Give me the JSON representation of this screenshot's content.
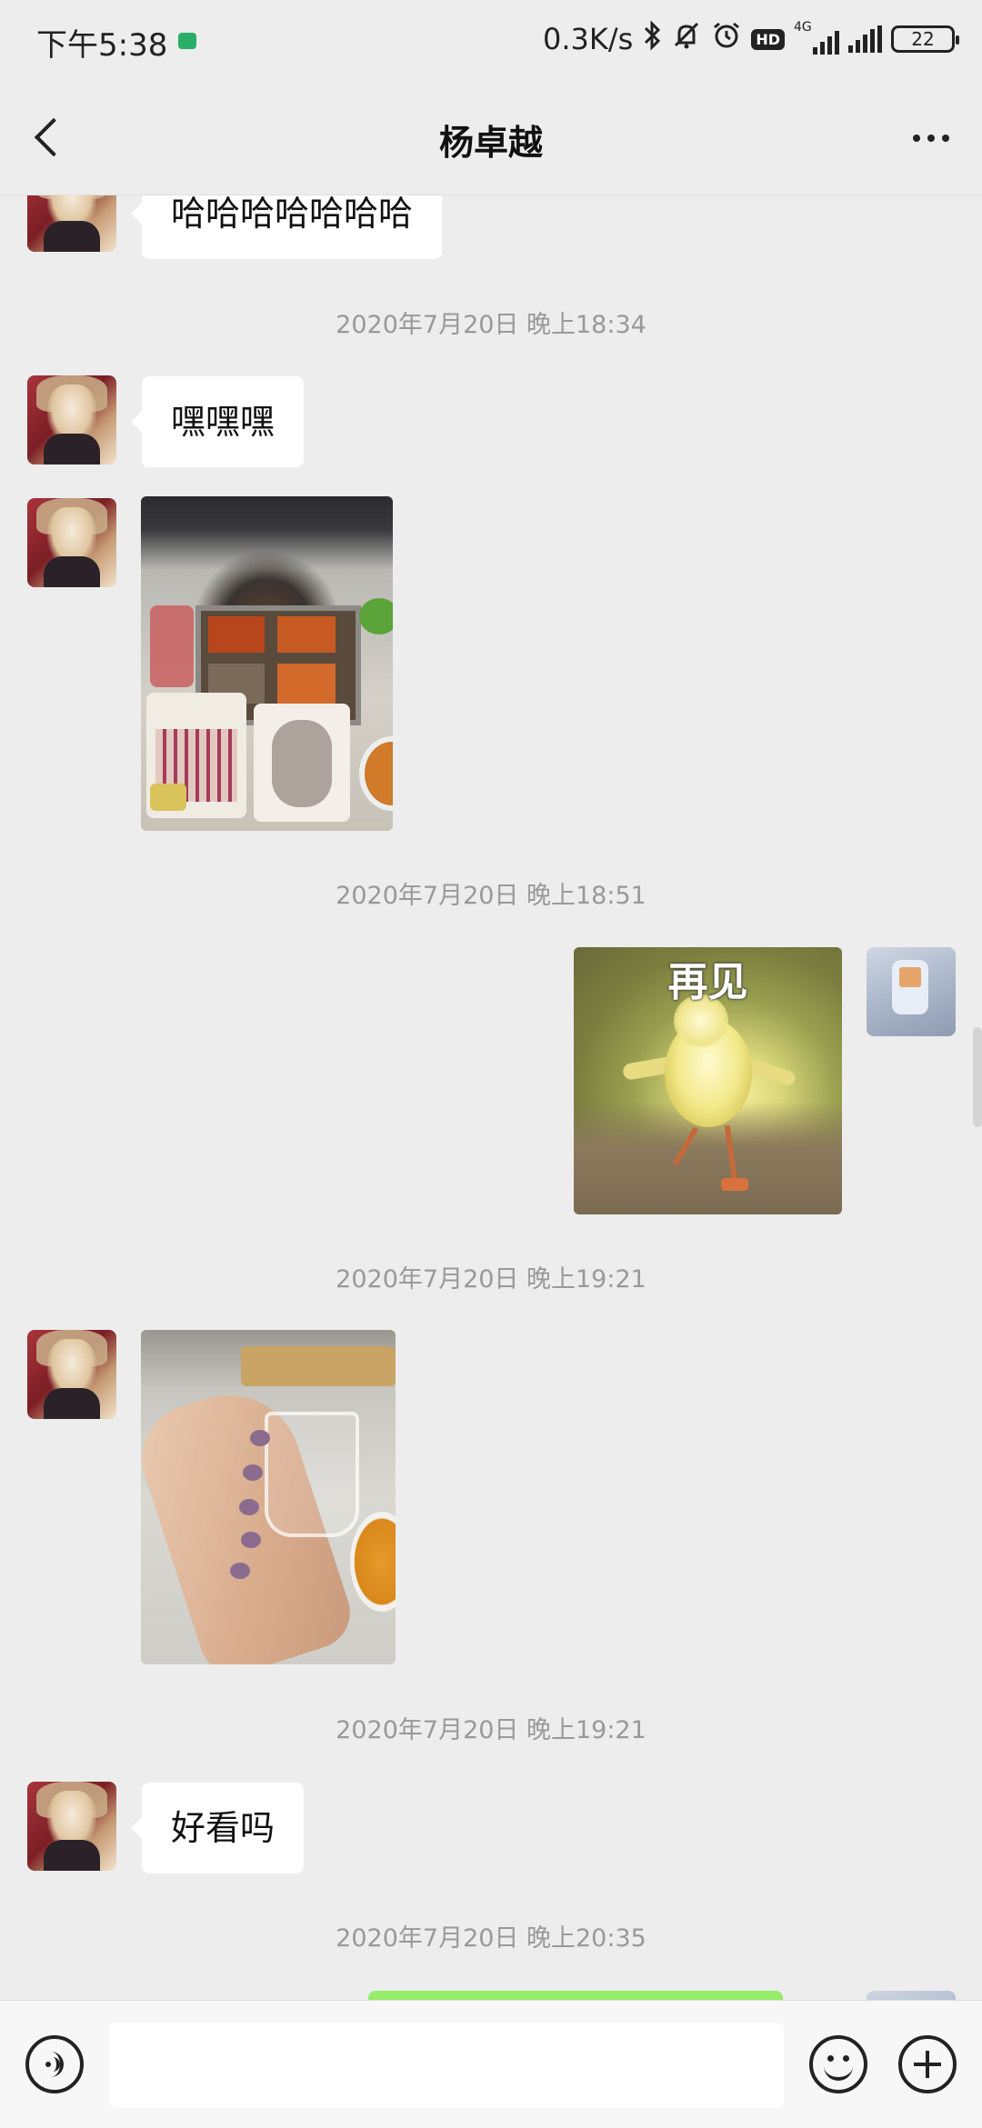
{
  "status_bar": {
    "time": "下午5:38",
    "net_speed": "0.3K/s",
    "network_type": "4G",
    "hd_label": "HD",
    "battery": "22",
    "icons": [
      "wechat-notification-icon",
      "bluetooth-icon",
      "mute-icon",
      "alarm-icon",
      "hd-icon",
      "signal-icon",
      "signal-icon",
      "battery-icon"
    ]
  },
  "header": {
    "title": "杨卓越",
    "back_icon": "chevron-left-icon",
    "more_icon": "more-dots-icon"
  },
  "messages": [
    {
      "type": "text",
      "sender": "other",
      "text": "哈哈哈哈哈哈哈"
    },
    {
      "type": "timestamp",
      "text": "2020年7月20日 晚上18:34"
    },
    {
      "type": "text",
      "sender": "other",
      "text": "嘿嘿嘿"
    },
    {
      "type": "image",
      "sender": "other",
      "subject": "hotpot-photo"
    },
    {
      "type": "timestamp",
      "text": "2020年7月20日 晚上18:51"
    },
    {
      "type": "sticker",
      "sender": "me",
      "caption": "再见"
    },
    {
      "type": "timestamp",
      "text": "2020年7月20日 晚上19:21"
    },
    {
      "type": "image",
      "sender": "other",
      "subject": "hand-nails-photo"
    },
    {
      "type": "timestamp",
      "text": "2020年7月20日 晚上19:21"
    },
    {
      "type": "text",
      "sender": "other",
      "text": "好看吗"
    },
    {
      "type": "timestamp",
      "text": "2020年7月20日 晚上20:35"
    },
    {
      "type": "text",
      "sender": "me",
      "text": ""
    }
  ],
  "input_bar": {
    "value": "",
    "placeholder": "",
    "icons": [
      "voice-icon",
      "emoji-icon",
      "plus-icon"
    ]
  },
  "colors": {
    "background": "#ededed",
    "bubble_other": "#ffffff",
    "bubble_me": "#95ec69",
    "timestamp": "#999999"
  }
}
